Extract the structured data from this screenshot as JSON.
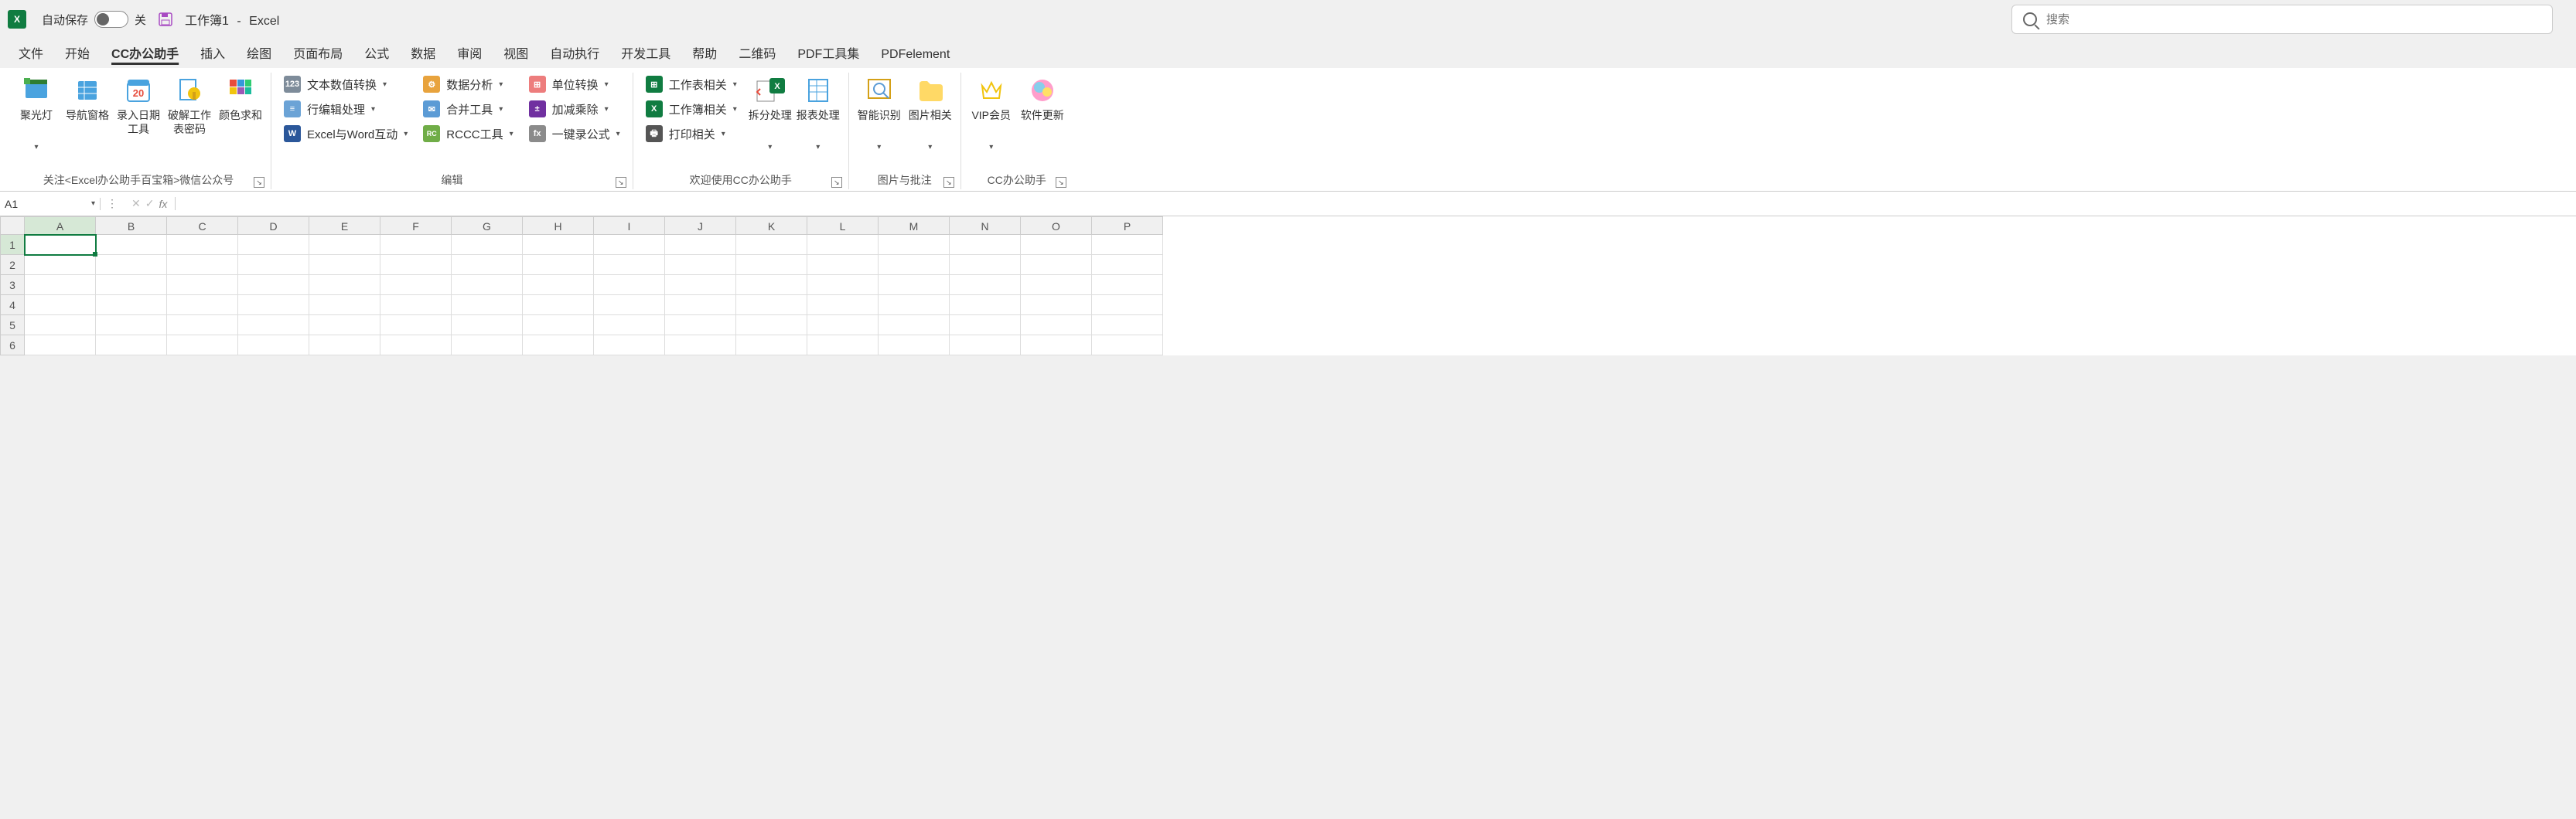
{
  "titlebar": {
    "autosave_label": "自动保存",
    "autosave_state": "关",
    "doc_name": "工作簿1",
    "app_name": "Excel",
    "separator": "-"
  },
  "search": {
    "placeholder": "搜索"
  },
  "tabs": {
    "items": [
      {
        "label": "文件"
      },
      {
        "label": "开始"
      },
      {
        "label": "CC办公助手"
      },
      {
        "label": "插入"
      },
      {
        "label": "绘图"
      },
      {
        "label": "页面布局"
      },
      {
        "label": "公式"
      },
      {
        "label": "数据"
      },
      {
        "label": "审阅"
      },
      {
        "label": "视图"
      },
      {
        "label": "自动执行"
      },
      {
        "label": "开发工具"
      },
      {
        "label": "帮助"
      },
      {
        "label": "二维码"
      },
      {
        "label": "PDF工具集"
      },
      {
        "label": "PDFelement"
      }
    ],
    "active_index": 2
  },
  "ribbon": {
    "group1": {
      "label": "关注<Excel办公助手百宝箱>微信公众号",
      "btns": [
        {
          "label": "聚光灯"
        },
        {
          "label": "导航窗格"
        },
        {
          "label": "录入日期工具"
        },
        {
          "label": "破解工作表密码"
        },
        {
          "label": "颜色求和"
        }
      ]
    },
    "group2": {
      "label": "编辑",
      "col1": [
        {
          "label": "文本数值转换"
        },
        {
          "label": "行编辑处理"
        },
        {
          "label": "Excel与Word互动"
        }
      ],
      "col2": [
        {
          "label": "数据分析"
        },
        {
          "label": "合并工具"
        },
        {
          "label": "RCCC工具"
        }
      ],
      "col3": [
        {
          "label": "单位转换"
        },
        {
          "label": "加减乘除"
        },
        {
          "label": "一键录公式"
        }
      ]
    },
    "group3": {
      "label": "欢迎使用CC办公助手",
      "col1": [
        {
          "label": "工作表相关"
        },
        {
          "label": "工作簿相关"
        },
        {
          "label": "打印相关"
        }
      ],
      "big": [
        {
          "label": "拆分处理"
        },
        {
          "label": "报表处理"
        }
      ]
    },
    "group4": {
      "label": "图片与批注",
      "big": [
        {
          "label": "智能识别"
        },
        {
          "label": "图片相关"
        }
      ]
    },
    "group5": {
      "label": "CC办公助手",
      "big": [
        {
          "label": "VIP会员"
        },
        {
          "label": "软件更新"
        }
      ]
    }
  },
  "formula": {
    "name_box": "A1",
    "fx": "fx"
  },
  "sheet": {
    "columns": [
      "A",
      "B",
      "C",
      "D",
      "E",
      "F",
      "G",
      "H",
      "I",
      "J",
      "K",
      "L",
      "M",
      "N",
      "O",
      "P"
    ],
    "rows": [
      "1",
      "2",
      "3",
      "4",
      "5",
      "6"
    ],
    "active": {
      "col": 0,
      "row": 0
    }
  }
}
